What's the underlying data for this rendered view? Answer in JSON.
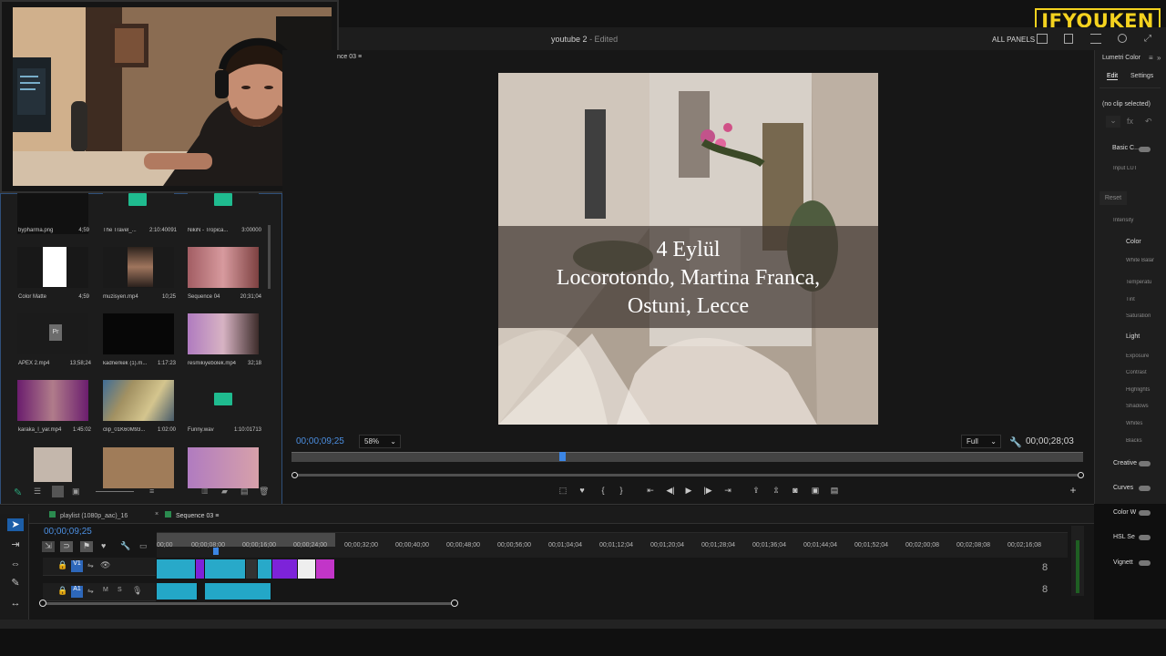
{
  "branding": {
    "overlay_logo": "IFYOUKEN"
  },
  "window": {
    "project_title": "youtube 2",
    "status": "- Edited",
    "all_panels": "ALL PANELS"
  },
  "project_panel": {
    "items": [
      {
        "label": "bypharma.png",
        "duration": "4;59",
        "icon": "image-thumbnail"
      },
      {
        "label": "The Travel_...",
        "duration": "2:10:40091",
        "icon": "audio-waveform-icon"
      },
      {
        "label": "NikiN - Tropica...",
        "duration": "3:00000",
        "icon": "audio-waveform-icon"
      },
      {
        "label": "Color Matte",
        "duration": "4;59",
        "icon": "color-matte-thumbnail"
      },
      {
        "label": "muzisyen.mp4",
        "duration": "10;25",
        "icon": "video-thumbnail"
      },
      {
        "label": "Sequence 04",
        "duration": "20;31;04",
        "icon": "sequence-thumbnail"
      },
      {
        "label": "APEX 2.mp4",
        "duration": "13;58;24",
        "icon": "premiere-project-icon"
      },
      {
        "label": "kadnerkek (1).m...",
        "duration": "1:17:23",
        "icon": "black-video-thumbnail"
      },
      {
        "label": "resmikiyebolek.mp4",
        "duration": "32;18",
        "icon": "video-thumbnail"
      },
      {
        "label": "karaka_l_yar.mp4",
        "duration": "1:45:02",
        "icon": "video-thumbnail"
      },
      {
        "label": "clip_01K60M93...",
        "duration": "1:02:00",
        "icon": "video-thumbnail"
      },
      {
        "label": "Funny.wav",
        "duration": "1:10:01713",
        "icon": "audio-waveform-icon"
      }
    ]
  },
  "program_monitor": {
    "sequence_tab": "nce 03",
    "caption": {
      "line1": "4 Eylül",
      "line2": "Locorotondo, Martina Franca,",
      "line3": "Ostuni, Lecce"
    },
    "current_time": "00;00;09;25",
    "zoom": "58%",
    "quality": "Full",
    "duration": "00;00;28;03",
    "playhead_fraction": 0.34
  },
  "lumetri": {
    "title": "Lumetri Color",
    "edit": "Edit",
    "settings": "Settings",
    "no_clip": "(no clip selected)",
    "sections": [
      {
        "label": "Basic Correction",
        "display": "Basic C..."
      },
      {
        "label": "Input LUT",
        "display": "Input LUT"
      },
      {
        "label": "Reset",
        "display": "Reset"
      },
      {
        "label": "Intensity",
        "display": "Intensity"
      },
      {
        "label": "Color",
        "display": "Color"
      },
      {
        "label": "White Balance",
        "display": "White Balar"
      },
      {
        "label": "Temperature",
        "display": "Temperatu"
      },
      {
        "label": "Tint",
        "display": "Tint"
      },
      {
        "label": "Saturation",
        "display": "Saturation"
      },
      {
        "label": "Light",
        "display": "Light"
      },
      {
        "label": "Exposure",
        "display": "Exposure"
      },
      {
        "label": "Contrast",
        "display": "Contrast"
      },
      {
        "label": "Highlights",
        "display": "Highlights"
      },
      {
        "label": "Shadows",
        "display": "Shadows"
      },
      {
        "label": "Whites",
        "display": "Whites"
      },
      {
        "label": "Blacks",
        "display": "Blacks"
      },
      {
        "label": "Creative",
        "display": "Creative"
      },
      {
        "label": "Curves",
        "display": "Curves"
      },
      {
        "label": "Color Wheels",
        "display": "Color W"
      },
      {
        "label": "HSL Secondary",
        "display": "HSL Se"
      },
      {
        "label": "Vignette",
        "display": "Vignett"
      }
    ]
  },
  "timeline": {
    "tab_playlist": "playlist (1080p_aac)_16",
    "tab_sequence": "Sequence 03",
    "timecode": "00;00;09;25",
    "ruler": [
      "00;00",
      "00;00;08;00",
      "00;00;16;00",
      "00;00;24;00",
      "00;00;32;00",
      "00;00;40;00",
      "00;00;48;00",
      "00;00;56;00",
      "00;01;04;04",
      "00;01;12;04",
      "00;01;20;04",
      "00;01;28;04",
      "00;01;36;04",
      "00;01;44;04",
      "00;01;52;04",
      "00;02;00;08",
      "00;02;08;08",
      "00;02;16;08"
    ],
    "video_track": "V1",
    "audio_track": "A1",
    "mute": "M",
    "solo": "S"
  },
  "colors": {
    "accent_blue": "#2d7ee8",
    "clip_cyan": "#28a9c9",
    "clip_purple": "#7d23d9",
    "clip_magenta": "#c235c8"
  }
}
